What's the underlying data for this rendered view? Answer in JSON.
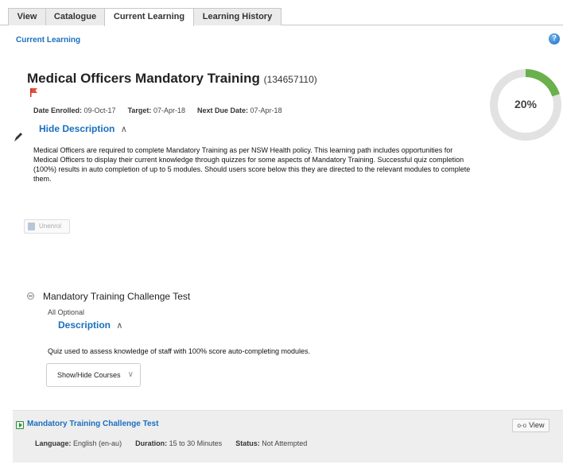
{
  "tabs": [
    {
      "label": "View"
    },
    {
      "label": "Catalogue"
    },
    {
      "label": "Current Learning",
      "active": true
    },
    {
      "label": "Learning History"
    }
  ],
  "breadcrumb": "Current Learning",
  "help_icon": "?",
  "course": {
    "title": "Medical Officers Mandatory Training",
    "code": "(134657110)",
    "date_enrolled_label": "Date Enrolled:",
    "date_enrolled": "09-Oct-17",
    "target_label": "Target:",
    "target": "07-Apr-18",
    "next_due_label": "Next Due Date:",
    "next_due": "07-Apr-18",
    "hide_description": "Hide Description",
    "description": "Medical Officers are required to complete Mandatory Training as per NSW Health policy. This learning path includes opportunities for Medical Officers to display their current knowledge through quizzes for some aspects of Mandatory Training. Successful quiz completion (100%) results in auto completion of up to 5 modules. Should users score below this they are directed to the relevant modules to complete them.",
    "unenrol": "Unenrol"
  },
  "progress": {
    "label": "20%",
    "value": 0.2,
    "color": "#6ab04c",
    "track_color": "#e2e2e2"
  },
  "section": {
    "title": "Mandatory Training Challenge Test",
    "optional": "All Optional",
    "description_toggle": "Description",
    "description": "Quiz used to assess knowledge of staff with 100% score auto-completing modules.",
    "show_hide": "Show/Hide Courses"
  },
  "module": {
    "title": "Mandatory Training Challenge Test",
    "view_label": "View",
    "language_label": "Language:",
    "language": "English (en-au)",
    "duration_label": "Duration:",
    "duration": "15 to 30 Minutes",
    "status_label": "Status:",
    "status": "Not Attempted"
  }
}
